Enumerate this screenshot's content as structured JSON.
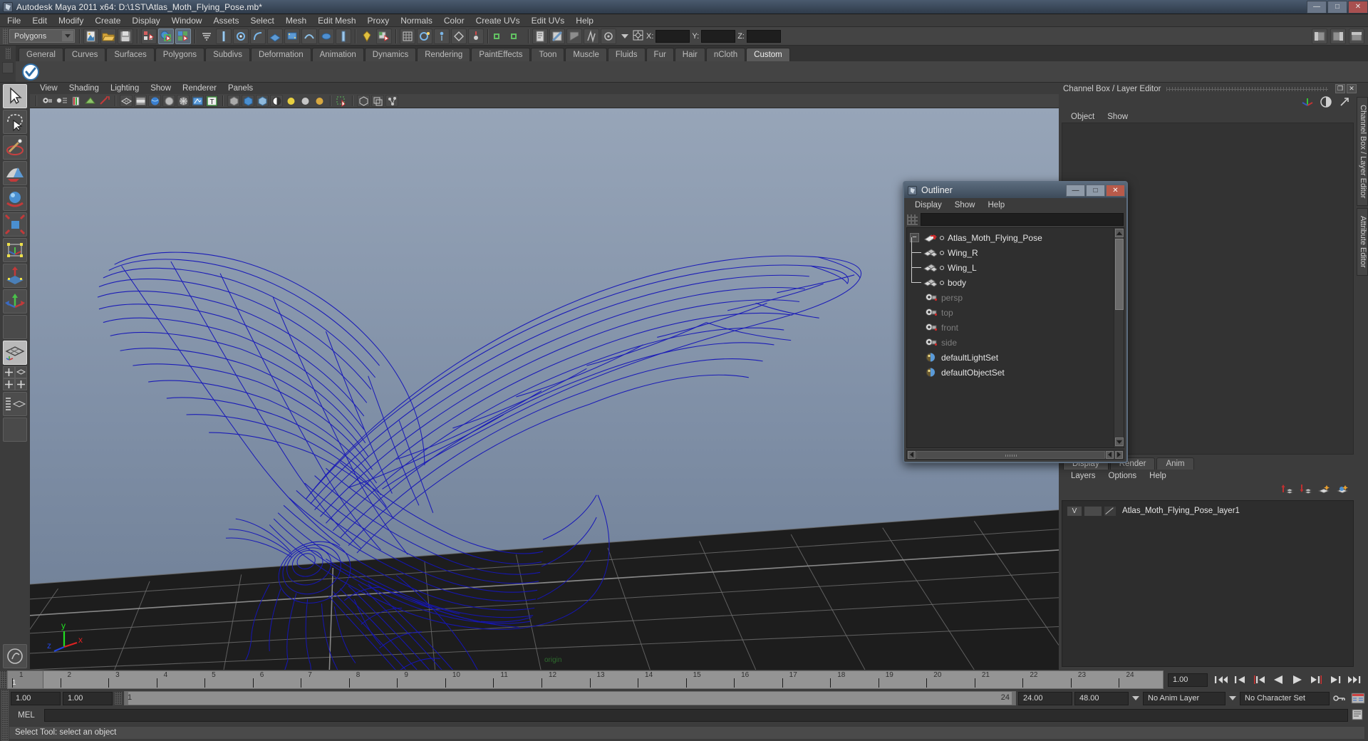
{
  "window": {
    "title": "Autodesk Maya 2011 x64: D:\\1ST\\Atlas_Moth_Flying_Pose.mb*",
    "minimize_label": "—",
    "maximize_label": "□",
    "close_label": "✕"
  },
  "menubar": {
    "items": [
      "File",
      "Edit",
      "Modify",
      "Create",
      "Display",
      "Window",
      "Assets",
      "Select",
      "Mesh",
      "Edit Mesh",
      "Proxy",
      "Normals",
      "Color",
      "Create UVs",
      "Edit UVs",
      "Help"
    ]
  },
  "statusline": {
    "mode_selected": "Polygons",
    "coord_labels": {
      "x": "X:",
      "y": "Y:",
      "z": "Z:"
    },
    "coord_values": {
      "x": "",
      "y": "",
      "z": ""
    }
  },
  "shelf": {
    "tabs": [
      "General",
      "Curves",
      "Surfaces",
      "Polygons",
      "Subdivs",
      "Deformation",
      "Animation",
      "Dynamics",
      "Rendering",
      "PaintEffects",
      "Toon",
      "Muscle",
      "Fluids",
      "Fur",
      "Hair",
      "nCloth",
      "Custom"
    ],
    "selected_tab": "Custom"
  },
  "viewport": {
    "menu": [
      "View",
      "Shading",
      "Lighting",
      "Show",
      "Renderer",
      "Panels"
    ],
    "axis_labels": {
      "x": "x",
      "y": "y",
      "z": "z"
    },
    "origin_label": "origin",
    "bg_top": "#8d9cb1",
    "bg_bottom": "#6f7f95",
    "wireframe_color": "#1414b4",
    "grid_color": "#6e6e6e"
  },
  "outliner": {
    "title": "Outliner",
    "menu": [
      "Display",
      "Show",
      "Help"
    ],
    "search_value": "",
    "buttons": {
      "minimize": "—",
      "maximize": "□",
      "close": "✕"
    },
    "items": [
      {
        "name": "Atlas_Moth_Flying_Pose",
        "icon": "transform-icon",
        "dim": false,
        "level": 0,
        "expanded": true
      },
      {
        "name": "Wing_R",
        "icon": "mesh-icon",
        "dim": false,
        "level": 1
      },
      {
        "name": "Wing_L",
        "icon": "mesh-icon",
        "dim": false,
        "level": 1
      },
      {
        "name": "body",
        "icon": "mesh-icon",
        "dim": false,
        "level": 1
      },
      {
        "name": "persp",
        "icon": "camera-icon",
        "dim": true,
        "level": 1
      },
      {
        "name": "top",
        "icon": "camera-icon",
        "dim": true,
        "level": 1
      },
      {
        "name": "front",
        "icon": "camera-icon",
        "dim": true,
        "level": 1
      },
      {
        "name": "side",
        "icon": "camera-icon",
        "dim": true,
        "level": 1
      },
      {
        "name": "defaultLightSet",
        "icon": "set-icon",
        "dim": false,
        "level": 1
      },
      {
        "name": "defaultObjectSet",
        "icon": "set-icon",
        "dim": false,
        "level": 1
      }
    ]
  },
  "channelbox": {
    "title": "Channel Box / Layer Editor",
    "menu": [
      "Object",
      "Show"
    ],
    "vertical_tabs": [
      "Channel Box / Layer Editor",
      "Attribute Editor"
    ]
  },
  "layereditor": {
    "tabs": [
      "Display",
      "Render",
      "Anim"
    ],
    "selected_tab": "Display",
    "menu": [
      "Layers",
      "Options",
      "Help"
    ],
    "rows": [
      {
        "visibility": "V",
        "playback": "",
        "name": "Atlas_Moth_Flying_Pose_layer1"
      }
    ]
  },
  "timeslider": {
    "ticks": [
      "1",
      "2",
      "3",
      "4",
      "5",
      "6",
      "7",
      "8",
      "9",
      "10",
      "11",
      "12",
      "13",
      "14",
      "15",
      "16",
      "17",
      "18",
      "19",
      "20",
      "21",
      "22",
      "23",
      "24"
    ],
    "current_frame_label": "1",
    "current_time_field": "1.00",
    "playback_buttons": [
      "go-to-start",
      "step-back-key",
      "step-back-frame",
      "play-backwards",
      "play-forwards",
      "step-forward-frame",
      "step-forward-key",
      "go-to-end"
    ]
  },
  "rangeslider": {
    "anim_start": "1.00",
    "range_start": "1.00",
    "range_bar_left": "1",
    "range_bar_right": "24",
    "range_end": "24.00",
    "anim_end": "48.00",
    "anim_layer": "No Anim Layer",
    "character_set": "No Character Set"
  },
  "command": {
    "label": "MEL",
    "value": ""
  },
  "status": {
    "message": "Select Tool: select an object"
  }
}
